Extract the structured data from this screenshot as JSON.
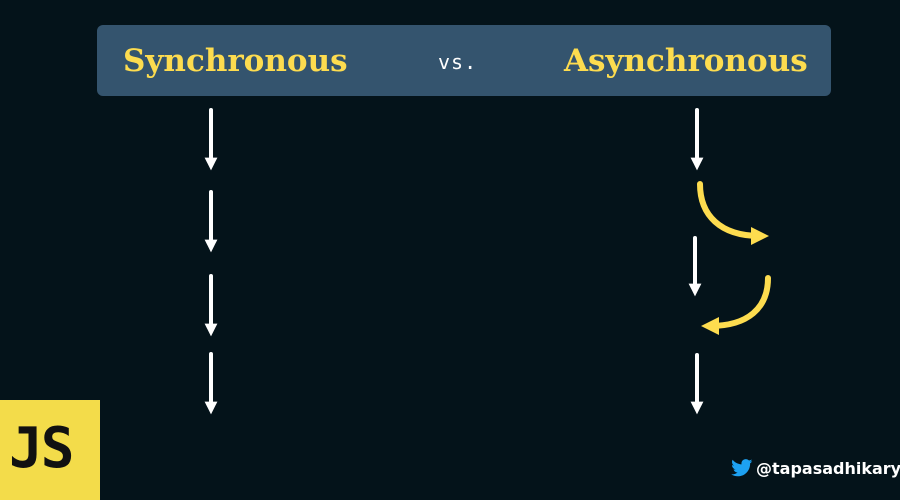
{
  "header": {
    "left_title": "Synchronous",
    "separator": "vs.",
    "right_title": "Asynchronous"
  },
  "badge": {
    "label": "JS"
  },
  "credit": {
    "icon": "twitter-bird-icon",
    "handle": "@tapasadhikary"
  },
  "colors": {
    "background": "#04131a",
    "banner": "#34546e",
    "accent_yellow": "#fddc4f",
    "arrow_white": "#ffffff",
    "badge_yellow": "#f3dc4a",
    "twitter_blue": "#1da1f2"
  }
}
